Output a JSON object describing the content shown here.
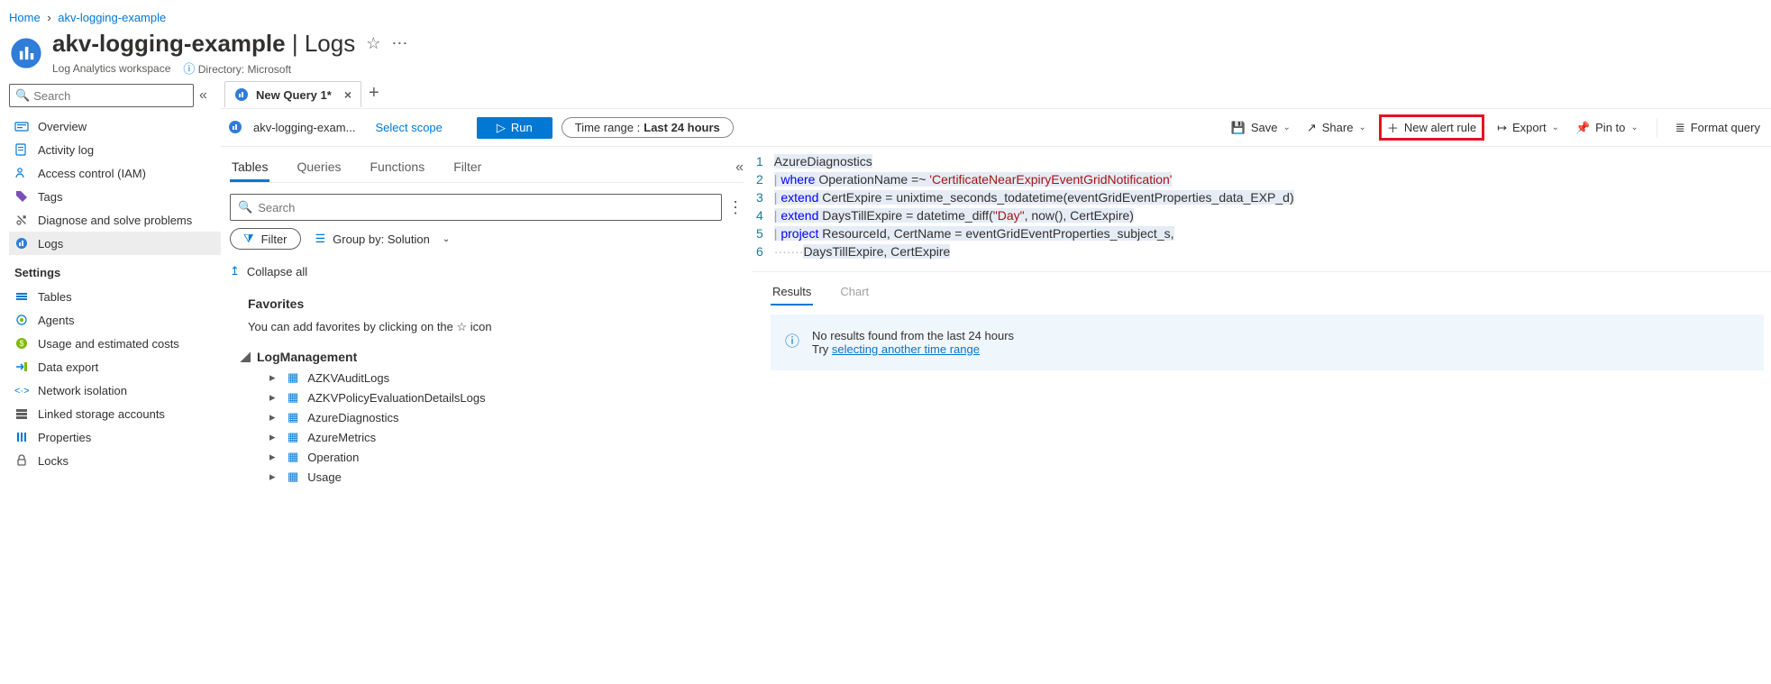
{
  "breadcrumb": {
    "home": "Home",
    "resource": "akv-logging-example"
  },
  "header": {
    "title": "akv-logging-example",
    "section": "Logs",
    "subtitle": "Log Analytics workspace",
    "directory_label": "Directory: Microsoft"
  },
  "sidebar": {
    "search_placeholder": "Search",
    "items": [
      {
        "label": "Overview",
        "icon": "overview-icon"
      },
      {
        "label": "Activity log",
        "icon": "activity-log-icon"
      },
      {
        "label": "Access control (IAM)",
        "icon": "access-control-icon"
      },
      {
        "label": "Tags",
        "icon": "tags-icon"
      },
      {
        "label": "Diagnose and solve problems",
        "icon": "diagnose-icon"
      },
      {
        "label": "Logs",
        "icon": "logs-icon",
        "active": true
      }
    ],
    "settings_heading": "Settings",
    "settings": [
      {
        "label": "Tables",
        "icon": "tables-icon"
      },
      {
        "label": "Agents",
        "icon": "agents-icon"
      },
      {
        "label": "Usage and estimated costs",
        "icon": "usage-icon"
      },
      {
        "label": "Data export",
        "icon": "data-export-icon"
      },
      {
        "label": "Network isolation",
        "icon": "network-isolation-icon"
      },
      {
        "label": "Linked storage accounts",
        "icon": "linked-storage-icon"
      },
      {
        "label": "Properties",
        "icon": "properties-icon"
      },
      {
        "label": "Locks",
        "icon": "locks-icon"
      }
    ]
  },
  "tabs": {
    "query_tab": "New Query 1*"
  },
  "toolbar": {
    "scope": "akv-logging-exam...",
    "select_scope": "Select scope",
    "run": "Run",
    "time_label": "Time range :",
    "time_value": "Last 24 hours",
    "save": "Save",
    "share": "Share",
    "new_alert": "New alert rule",
    "export": "Export",
    "pin": "Pin to",
    "format": "Format query"
  },
  "explorer": {
    "tabs": [
      "Tables",
      "Queries",
      "Functions",
      "Filter"
    ],
    "search_placeholder": "Search",
    "filter": "Filter",
    "groupby": "Group by: Solution",
    "collapse_all": "Collapse all",
    "favorites": "Favorites",
    "favorites_hint_pre": "You can add favorites by clicking on the ",
    "favorites_hint_post": " icon",
    "group": "LogManagement",
    "tables": [
      "AZKVAuditLogs",
      "AZKVPolicyEvaluationDetailsLogs",
      "AzureDiagnostics",
      "AzureMetrics",
      "Operation",
      "Usage"
    ]
  },
  "editor": {
    "lines": {
      "l1": "AzureDiagnostics",
      "l2a": "| ",
      "l2b": "where",
      "l2c": " OperationName =~ ",
      "l2d": "'CertificateNearExpiryEventGridNotification'",
      "l3a": "| ",
      "l3b": "extend",
      "l3c": " CertExpire = unixtime_seconds_todatetime(eventGridEventProperties_data_EXP_d)",
      "l4a": "| ",
      "l4b": "extend",
      "l4c": " DaysTillExpire = datetime_diff(",
      "l4d": "\"Day\"",
      "l4e": ", now(), CertExpire)",
      "l5a": "| ",
      "l5b": "project",
      "l5c": " ResourceId, CertName = eventGridEventProperties_subject_s,",
      "l6": "DaysTillExpire, CertExpire"
    }
  },
  "results": {
    "tabs": [
      "Results",
      "Chart"
    ],
    "none": "No results found from the last 24 hours",
    "try": "Try ",
    "link": "selecting another time range"
  }
}
